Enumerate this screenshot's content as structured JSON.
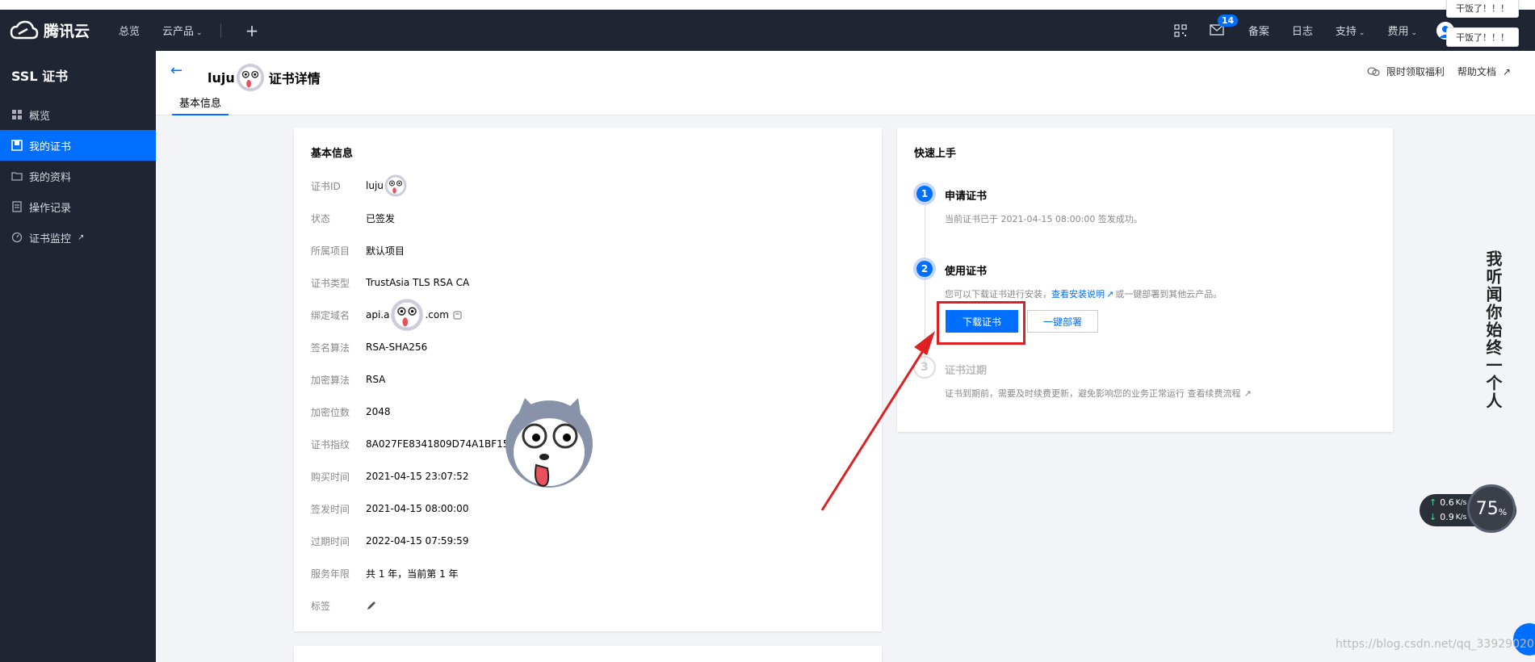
{
  "topnav": {
    "brand": "腾讯云",
    "items": [
      "总览",
      "云产品"
    ],
    "plus": "+",
    "right_items": [
      "备案",
      "日志",
      "支持",
      "费用"
    ],
    "mail_badge": "14"
  },
  "float_notes": [
    "干饭了！！！",
    "干饭了！！！"
  ],
  "sidebar": {
    "title": "SSL 证书",
    "items": [
      {
        "label": "概览",
        "icon": "grid-icon"
      },
      {
        "label": "我的证书",
        "icon": "certificate-icon"
      },
      {
        "label": "我的资料",
        "icon": "folder-icon"
      },
      {
        "label": "操作记录",
        "icon": "log-icon"
      },
      {
        "label": "证书监控",
        "icon": "monitor-icon"
      }
    ]
  },
  "header": {
    "title_prefix": "luju",
    "title_suffix": "证书详情",
    "links": [
      "限时领取福利",
      "帮助文档"
    ],
    "tab": "基本信息"
  },
  "basic_info": {
    "title": "基本信息",
    "rows": [
      {
        "k": "证书ID",
        "v": "luju"
      },
      {
        "k": "状态",
        "v": "已签发"
      },
      {
        "k": "所属项目",
        "v": "默认项目"
      },
      {
        "k": "证书类型",
        "v": "TrustAsia TLS RSA CA"
      },
      {
        "k": "绑定域名",
        "v": "api.a",
        "v2": ".com"
      },
      {
        "k": "签名算法",
        "v": "RSA-SHA256"
      },
      {
        "k": "加密算法",
        "v": "RSA"
      },
      {
        "k": "加密位数",
        "v": "2048"
      },
      {
        "k": "证书指纹",
        "v": "8A027FE8341809D74A1BF152"
      },
      {
        "k": "购买时间",
        "v": "2021-04-15 23:07:52"
      },
      {
        "k": "签发时间",
        "v": "2021-04-15 08:00:00"
      },
      {
        "k": "过期时间",
        "v": "2022-04-15 07:59:59"
      },
      {
        "k": "服务年限",
        "v": "共 1 年，当前第 1 年"
      },
      {
        "k": "标签",
        "v": ""
      }
    ]
  },
  "quick_start": {
    "title": "快速上手",
    "steps": [
      {
        "num": "1",
        "title": "申请证书",
        "desc": "当前证书已于 2021-04-15 08:00:00 签发成功。"
      },
      {
        "num": "2",
        "title": "使用证书",
        "desc_a": "您可以下载证书进行安装，",
        "link": "查看安装说明",
        "desc_b": "或一键部署到其他云产品。"
      },
      {
        "num": "3",
        "title": "证书过期",
        "desc": "证书到期前，需要及时续费更新，避免影响您的业务正常运行 查看续费流程"
      }
    ],
    "download_btn": "下载证书",
    "deploy_btn": "一键部署"
  },
  "overlay": {
    "vertical_text": "我听闻你始终一个人",
    "net_up": "0.6",
    "net_down": "0.9",
    "net_unit": "K/s",
    "percent": "75",
    "percent_unit": "%",
    "watermark": "https://blog.csdn.net/qq_33929020"
  },
  "colors": {
    "accent": "#006eff",
    "nav_bg": "#1f2533",
    "highlight": "#e02020"
  }
}
